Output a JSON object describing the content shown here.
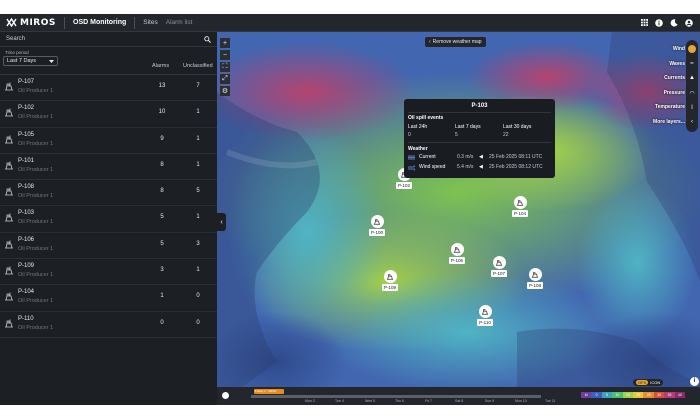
{
  "app": {
    "brand": "MIROS",
    "product": "OSD Monitoring",
    "nav": [
      "Sites",
      "Alarm list"
    ]
  },
  "sidebar": {
    "search_placeholder": "Search",
    "time_period_label": "Time period",
    "time_period_value": "Last 7 Days",
    "col_alarms": "Alarms",
    "col_unclassified": "Unclassified",
    "sites": [
      {
        "name": "P-107",
        "type": "Oil Producer 1",
        "alarms": "13",
        "unclassified": "7"
      },
      {
        "name": "P-102",
        "type": "Oil Producer 1",
        "alarms": "10",
        "unclassified": "1"
      },
      {
        "name": "P-105",
        "type": "Oil Producer 1",
        "alarms": "9",
        "unclassified": "1"
      },
      {
        "name": "P-101",
        "type": "Oil Producer 1",
        "alarms": "8",
        "unclassified": "1"
      },
      {
        "name": "P-108",
        "type": "Oil Producer 1",
        "alarms": "8",
        "unclassified": "5"
      },
      {
        "name": "P-103",
        "type": "Oil Producer 1",
        "alarms": "5",
        "unclassified": "1"
      },
      {
        "name": "P-106",
        "type": "Oil Producer 1",
        "alarms": "5",
        "unclassified": "3"
      },
      {
        "name": "P-109",
        "type": "Oil Producer 1",
        "alarms": "3",
        "unclassified": "1"
      },
      {
        "name": "P-104",
        "type": "Oil Producer 1",
        "alarms": "1",
        "unclassified": "0"
      },
      {
        "name": "P-110",
        "type": "Oil Producer 1",
        "alarms": "0",
        "unclassified": "0"
      }
    ]
  },
  "map": {
    "remove_weather": "Remove weather map",
    "layers": [
      "Wind",
      "Waves",
      "Currents",
      "Pressure",
      "Temperature",
      "More layers..."
    ],
    "markers": [
      "P-102",
      "P-104",
      "P-100",
      "P-106",
      "P-107",
      "P-108",
      "P-109",
      "P-110"
    ],
    "popup": {
      "title": "P-103",
      "oil_spill_label": "Oil spill events",
      "periods": [
        {
          "label": "Last 24h",
          "value": "0"
        },
        {
          "label": "Last 7 days",
          "value": "5"
        },
        {
          "label": "Last 30 days",
          "value": "22"
        }
      ],
      "weather_label": "Weather",
      "current_label": "Current",
      "current_value": "0.3 m/s",
      "current_time": "25 Feb 2025 08:11 UTC",
      "wind_label": "Wind speed",
      "wind_value": "5.4 m/s",
      "wind_time": "25 Feb 2025 08:12 UTC"
    },
    "timeline_label": "Friday 1 · 08:00",
    "timeline_ticks": [
      "Mon 3",
      "Tue 4",
      "Wed 5",
      "Thu 6",
      "Fri 7",
      "Sat 8",
      "Sun 9",
      "Mon 10",
      "Tue 11"
    ],
    "models": [
      "GFS",
      "ICON"
    ],
    "legend": [
      "kt",
      "0",
      "5",
      "10",
      "15",
      "20",
      "25",
      "30",
      "35",
      "40"
    ],
    "colors": {
      "legend": [
        "#6a3f9e",
        "#3d5fc0",
        "#3aa3b8",
        "#4cbf6c",
        "#9ed14a",
        "#e2c83a",
        "#e48c2f",
        "#d8503a",
        "#b83a78",
        "#8a2a6a"
      ]
    }
  }
}
